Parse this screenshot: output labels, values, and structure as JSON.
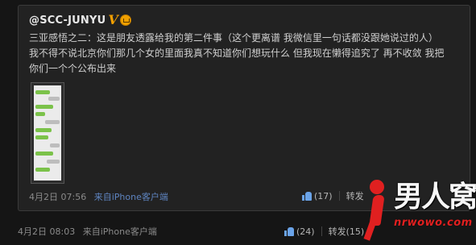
{
  "post": {
    "username": "@SCC-JUNYU",
    "verified_mark": "V",
    "text_lines": [
      "三亚感悟之二：这是朋友透露给我的第二件事（这个更离谱 我微信里一句话都没跟她说过的人）",
      "我不得不说北京你们那几个女的里面我真不知道你们想玩什么 但我现在懒得追究了 再不收敛 我把",
      "你们一个个公布出来"
    ],
    "time": "4月2日 07:56",
    "source": "来自iPhone客户端",
    "like_count": "(17)",
    "repost_label": "转发"
  },
  "outer": {
    "time": "4月2日 08:03",
    "source": "来自iPhone客户端",
    "like_count": "(24)",
    "repost": "转发(15)"
  },
  "watermark": {
    "cn": "男人窝",
    "url": "nrwowo.com"
  },
  "colors": {
    "background": "#151515",
    "card": "#222222",
    "link": "#5e84c0",
    "verified": "#f5a000",
    "like_icon": "#6aa3e8",
    "watermark_red": "#e02020"
  }
}
